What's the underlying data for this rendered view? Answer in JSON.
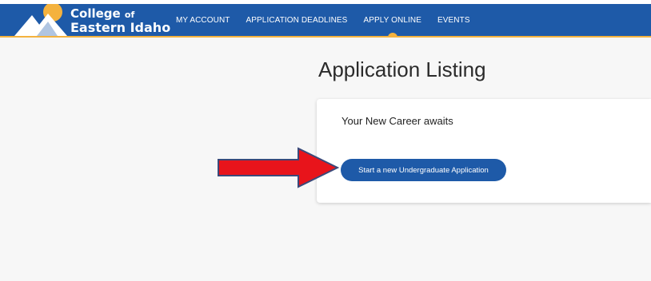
{
  "header": {
    "logo": {
      "line1": "College",
      "line1_suffix": "of",
      "line2": "Eastern Idaho"
    },
    "nav": [
      {
        "label": "MY ACCOUNT",
        "active": false
      },
      {
        "label": "APPLICATION DEADLINES",
        "active": false
      },
      {
        "label": "APPLY ONLINE",
        "active": true
      },
      {
        "label": "EVENTS",
        "active": false
      }
    ],
    "colors": {
      "nav_bg": "#1e5aa8",
      "accent": "#f4b23e"
    }
  },
  "main": {
    "title": "Application Listing",
    "card": {
      "heading": "Your New Career awaits",
      "button_label": "Start a new Undergraduate Application"
    },
    "annotation": {
      "icon": "arrow-right-icon",
      "color": "#e8141b"
    }
  }
}
